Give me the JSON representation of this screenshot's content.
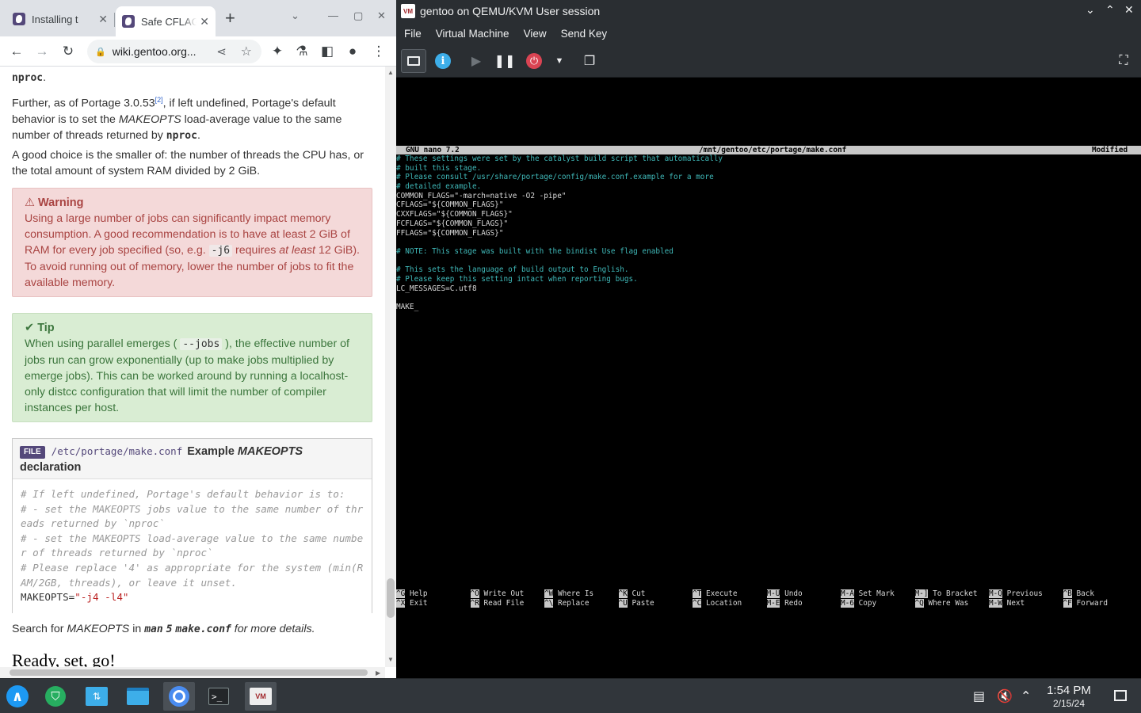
{
  "browser": {
    "tabs": [
      {
        "title": "Installing t",
        "close": "✕"
      },
      {
        "title": "Safe CFLAGS",
        "close": "✕"
      }
    ],
    "new_tab": "+",
    "url": "wiki.gentoo.org...",
    "content": {
      "p0": "nproc",
      "p1_a": "Further, as of Portage 3.0.53",
      "p1_sup": "[2]",
      "p1_b": ", if left undefined, Portage's default behavior is to set the ",
      "p1_em": "MAKEOPTS",
      "p1_c": " load-average value to the same number of threads returned by ",
      "p1_code": "nproc",
      "p1_d": ".",
      "p2": "A good choice is the smaller of: the number of threads the CPU has, or the total amount of system RAM divided by 2 GiB.",
      "warning_title": "Warning",
      "warning_a": "Using a large number of jobs can significantly impact memory consumption. A good recommendation is to have at least 2 GiB of RAM for every job specified (so, e.g. ",
      "warning_code": "-j6",
      "warning_b": " requires ",
      "warning_em": "at least",
      "warning_c": " 12 GiB). To avoid running out of memory, lower the number of jobs to fit the available memory.",
      "tip_title": "Tip",
      "tip_a": "When using parallel emerges ( ",
      "tip_code": "--jobs",
      "tip_b": " ), the effective number of jobs run can grow exponentially (up to make jobs multiplied by emerge jobs). This can be worked around by running a localhost-only distcc configuration that will limit the number of compiler instances per host.",
      "file_tag": "FILE",
      "file_path": "/etc/portage/make.conf",
      "file_desc_a": "Example ",
      "file_desc_em": "MAKEOPTS",
      "file_desc_b": "declaration",
      "code_comments": [
        "# If left undefined, Portage's default behavior is to:",
        "# - set the MAKEOPTS jobs value to the same number of threads returned by `nproc`",
        "# - set the MAKEOPTS load-average value to the same number of threads returned by `nproc`",
        "# Please replace '4' as appropriate for the system (min(RAM/2GB, threads), or leave it unset."
      ],
      "code_key": "MAKEOPTS=",
      "code_val": "\"-j4 -l4\"",
      "search_a": "Search for ",
      "search_em": "MAKEOPTS",
      "search_b": " in ",
      "search_code1": "man",
      "search_code2": "5",
      "search_code3": "make.conf",
      "search_c": " for more details.",
      "heading": "Ready, set, go!"
    }
  },
  "vm": {
    "title": "gentoo on QEMU/KVM User session",
    "logo": "VM",
    "menu": [
      "File",
      "Virtual Machine",
      "View",
      "Send Key"
    ],
    "nano": {
      "version": "GNU nano 7.2",
      "file": "/mnt/gentoo/etc/portage/make.conf",
      "status": "Modified",
      "lines": [
        {
          "t": "# These settings were set by the catalyst build script that automatically",
          "c": true
        },
        {
          "t": "# built this stage.",
          "c": true
        },
        {
          "t": "# Please consult /usr/share/portage/config/make.conf.example for a more",
          "c": true
        },
        {
          "t": "# detailed example.",
          "c": true
        },
        {
          "t": "COMMON_FLAGS=\"-march=native -O2 -pipe\"",
          "c": false
        },
        {
          "t": "CFLAGS=\"${COMMON_FLAGS}\"",
          "c": false
        },
        {
          "t": "CXXFLAGS=\"${COMMON_FLAGS}\"",
          "c": false
        },
        {
          "t": "FCFLAGS=\"${COMMON_FLAGS}\"",
          "c": false
        },
        {
          "t": "FFLAGS=\"${COMMON_FLAGS}\"",
          "c": false
        },
        {
          "t": "",
          "c": false
        },
        {
          "t": "# NOTE: This stage was built with the bindist Use flag enabled",
          "c": true
        },
        {
          "t": "",
          "c": false
        },
        {
          "t": "# This sets the language of build output to English.",
          "c": true
        },
        {
          "t": "# Please keep this setting intact when reporting bugs.",
          "c": true
        },
        {
          "t": "LC_MESSAGES=C.utf8",
          "c": false
        },
        {
          "t": "",
          "c": false
        },
        {
          "t": "MAKE_",
          "c": false
        }
      ],
      "shortcuts": [
        {
          "k1": "^G",
          "l1": "Help",
          "k2": "^X",
          "l2": "Exit"
        },
        {
          "k1": "^O",
          "l1": "Write Out",
          "k2": "^R",
          "l2": "Read File"
        },
        {
          "k1": "^W",
          "l1": "Where Is",
          "k2": "^\\",
          "l2": "Replace"
        },
        {
          "k1": "^K",
          "l1": "Cut",
          "k2": "^U",
          "l2": "Paste"
        },
        {
          "k1": "^T",
          "l1": "Execute",
          "k2": "^C",
          "l2": "Location"
        },
        {
          "k1": "M-U",
          "l1": "Undo",
          "k2": "M-E",
          "l2": "Redo"
        },
        {
          "k1": "M-A",
          "l1": "Set Mark",
          "k2": "M-6",
          "l2": "Copy"
        },
        {
          "k1": "M-]",
          "l1": "To Bracket",
          "k2": "^Q",
          "l2": "Where Was"
        },
        {
          "k1": "M-Q",
          "l1": "Previous",
          "k2": "M-W",
          "l2": "Next"
        },
        {
          "k1": "^B",
          "l1": "Back",
          "k2": "^F",
          "l2": "Forward"
        }
      ]
    }
  },
  "taskbar": {
    "konsole_glyph": ">_",
    "vmm_label": "VM",
    "time": "1:54 PM",
    "date": "2/15/24"
  },
  "colors": {
    "gentoo_purple": "#54487a",
    "warning_bg": "#f4d9d9",
    "tip_bg": "#d9edd3",
    "nano_comment": "#3fb8b8"
  }
}
